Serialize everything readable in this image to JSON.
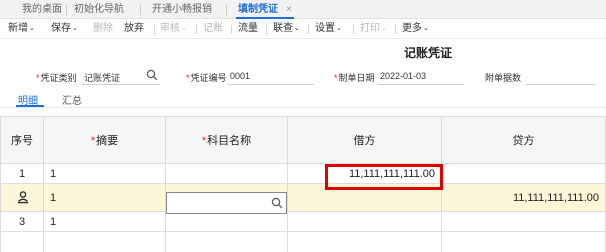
{
  "tabs": [
    {
      "label": "我的桌面"
    },
    {
      "label": "初始化导航"
    },
    {
      "label": "开通小畅报销"
    },
    {
      "label": "填制凭证",
      "active": true
    }
  ],
  "tab_close": "×",
  "toolbar": {
    "new": "新增",
    "save": "保存",
    "delete": "删除",
    "discard": "放弃",
    "review": "审核",
    "post": "记账",
    "flow": "流量",
    "lookup": "联查",
    "settings": "设置",
    "print": "打印",
    "more": "更多",
    "caret": "⌄"
  },
  "voucher": {
    "title": "记账凭证",
    "type_label": "凭证类别",
    "type_value": "记账凭证",
    "number_label": "凭证编号",
    "number_value": "0001",
    "date_label": "制单日期",
    "date_value": "2022-01-03",
    "attachments_label": "附单据数"
  },
  "subtabs": {
    "detail": "明细",
    "summary": "汇总"
  },
  "grid": {
    "headers": {
      "seq": "序号",
      "summary": "摘要",
      "account": "科目名称",
      "debit": "借方",
      "credit": "贷方"
    },
    "rows": [
      {
        "seq": "1",
        "summary": "1",
        "account": "",
        "debit": "11,111,111,111.00",
        "credit": ""
      },
      {
        "seq": "",
        "summary": "1",
        "account": "",
        "debit": "",
        "credit": "11,111,111,111.00"
      },
      {
        "seq": "3",
        "summary": "1",
        "account": "",
        "debit": "",
        "credit": ""
      }
    ]
  },
  "colors": {
    "accent": "#1f6fd6",
    "highlight": "#fdf7d9",
    "annotation": "#e00000"
  }
}
